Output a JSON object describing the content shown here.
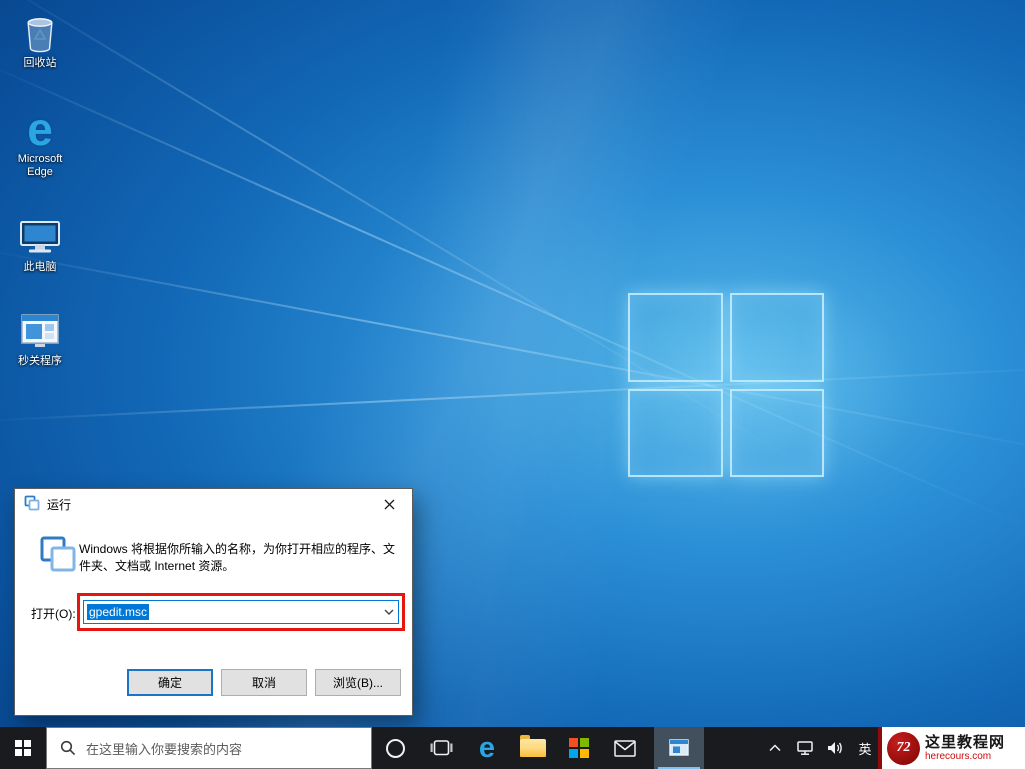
{
  "colors": {
    "accent": "#0078d7",
    "annotation_red": "#e8150f",
    "taskbar_bg": "#1a1b1f",
    "selection_bg": "#0078d7"
  },
  "icons": {
    "edge_glyph": "e",
    "watermark_logo_text": "72"
  },
  "desktop": {
    "icons": [
      {
        "label": "回收站"
      },
      {
        "label": "Microsoft Edge"
      },
      {
        "label": "此电脑"
      },
      {
        "label": "秒关程序"
      }
    ]
  },
  "run_dialog": {
    "title": "运行",
    "description": "Windows 将根据你所输入的名称，为你打开相应的程序、文件夹、文档或 Internet 资源。",
    "open_label": "打开(O):",
    "input_value": "gpedit.msc",
    "ok_label": "确定",
    "cancel_label": "取消",
    "browse_label": "浏览(B)..."
  },
  "taskbar": {
    "search_placeholder": "在这里输入你要搜索的内容",
    "ime_label": "英"
  },
  "watermark": {
    "title": "这里教程网",
    "url": "herecours.com"
  }
}
